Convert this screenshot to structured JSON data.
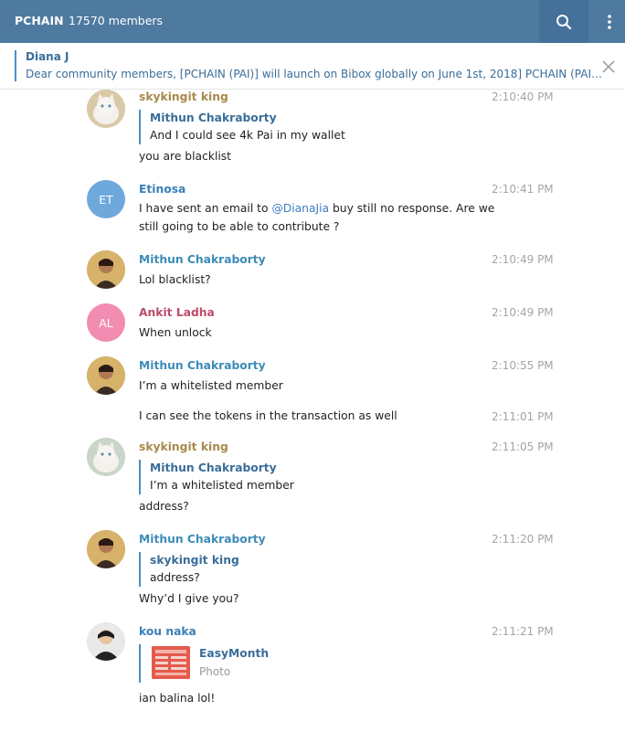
{
  "header": {
    "title": "PCHAIN",
    "members": "17570 members",
    "icons": [
      "search-icon",
      "more-vertical-icon"
    ],
    "bg": "#4f7aa0"
  },
  "pinned": {
    "name": "Diana J",
    "text": "Dear community members, [PCHAIN (PAI)] will launch on Bibox globally on June 1st, 2018] PCHAIN (PAI) w...",
    "icon": "close-icon"
  },
  "messages": [
    {
      "author": "skykingit king",
      "time": "2:10:40 PM",
      "avatar": "cat",
      "reply": {
        "name": "Mithun Chakraborty",
        "text": "And I could see 4k Pai in my wallet"
      },
      "text": "you are blacklist"
    },
    {
      "author": "Etinosa",
      "time": "2:10:41 PM",
      "avatar_initials": "ET",
      "text_pre": "I have sent an email to ",
      "mention": "@DianaJia",
      "text_post": " buy still no response. Are we",
      "text_line2": "still going to be able to contribute ?"
    },
    {
      "author": "Mithun Chakraborty",
      "time": "2:10:49 PM",
      "text": "Lol blacklist?"
    },
    {
      "author": "Ankit Ladha",
      "time": "2:10:49 PM",
      "avatar_initials": "AL",
      "text": "When unlock"
    },
    {
      "author": "Mithun Chakraborty",
      "time": "2:10:55 PM",
      "text": "I’m a whitelisted member"
    },
    {
      "time": "2:11:01 PM",
      "text": "I can see the tokens in the transaction as well"
    },
    {
      "author": "skykingit king",
      "time": "2:11:05 PM",
      "reply": {
        "name": "Mithun Chakraborty",
        "text": "I’m a whitelisted member"
      },
      "text": "address?"
    },
    {
      "author": "Mithun Chakraborty",
      "time": "2:11:20 PM",
      "reply": {
        "name": "skykingit king",
        "text": "address?"
      },
      "text": "Why’d I give you?"
    },
    {
      "author": "kou naka",
      "time": "2:11:21 PM",
      "reply": {
        "name": "EasyMonth",
        "text": "Photo"
      },
      "text": "ian balina lol!"
    }
  ]
}
